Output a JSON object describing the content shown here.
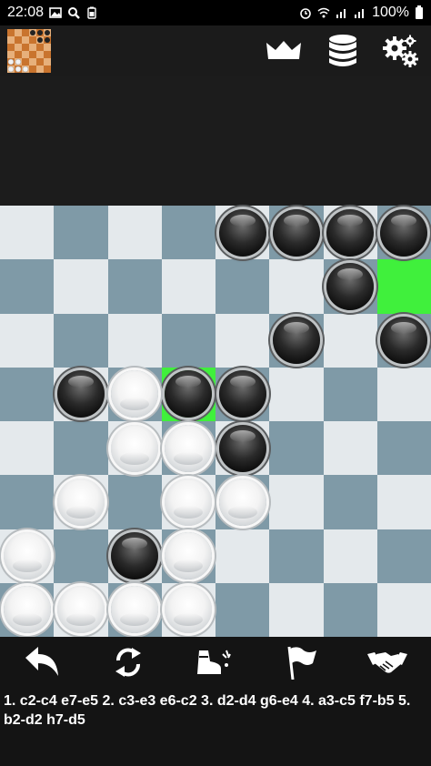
{
  "status_bar": {
    "time": "22:08",
    "battery": "100%",
    "left_icons": [
      "image-icon",
      "search-icon",
      "battery-saver-icon"
    ],
    "right_icons": [
      "alarm-icon",
      "wifi-icon",
      "signal-icon",
      "signal-icon",
      "battery-icon"
    ]
  },
  "toolbar": {
    "thumbnail_icon": "board-thumbnail-icon",
    "buttons": [
      {
        "name": "crown-button",
        "icon": "crown-icon"
      },
      {
        "name": "database-button",
        "icon": "database-icon"
      },
      {
        "name": "settings-button",
        "icon": "gears-icon"
      }
    ]
  },
  "board": {
    "size": 8,
    "highlights": [
      [
        1,
        7
      ],
      [
        3,
        3
      ]
    ],
    "pieces": {
      "black": [
        [
          0,
          4
        ],
        [
          0,
          5
        ],
        [
          0,
          6
        ],
        [
          0,
          7
        ],
        [
          1,
          6
        ],
        [
          2,
          5
        ],
        [
          2,
          7
        ],
        [
          3,
          1
        ],
        [
          3,
          3
        ],
        [
          3,
          4
        ],
        [
          4,
          4
        ],
        [
          6,
          2
        ]
      ],
      "white": [
        [
          3,
          2
        ],
        [
          4,
          2
        ],
        [
          4,
          3
        ],
        [
          5,
          1
        ],
        [
          5,
          3
        ],
        [
          5,
          4
        ],
        [
          6,
          0
        ],
        [
          6,
          3
        ],
        [
          7,
          0
        ],
        [
          7,
          1
        ],
        [
          7,
          2
        ],
        [
          7,
          3
        ]
      ]
    },
    "colors": {
      "light": "#e4e9ec",
      "dark": "#7f9aa7",
      "highlight": "#40f03c"
    }
  },
  "actions": [
    {
      "name": "undo-button",
      "icon": "undo-arrow-icon"
    },
    {
      "name": "flip-board-button",
      "icon": "rotate-arrows-icon"
    },
    {
      "name": "hint-button",
      "icon": "boot-kick-icon"
    },
    {
      "name": "resign-button",
      "icon": "flag-icon"
    },
    {
      "name": "draw-button",
      "icon": "handshake-icon"
    }
  ],
  "moves_text": "1. c2-c4 e7-e5  2. c3-e3 e6-c2  3. d2-d4 g6-e4  4. a3-c5 f7-b5  5. b2-d2 h7-d5"
}
